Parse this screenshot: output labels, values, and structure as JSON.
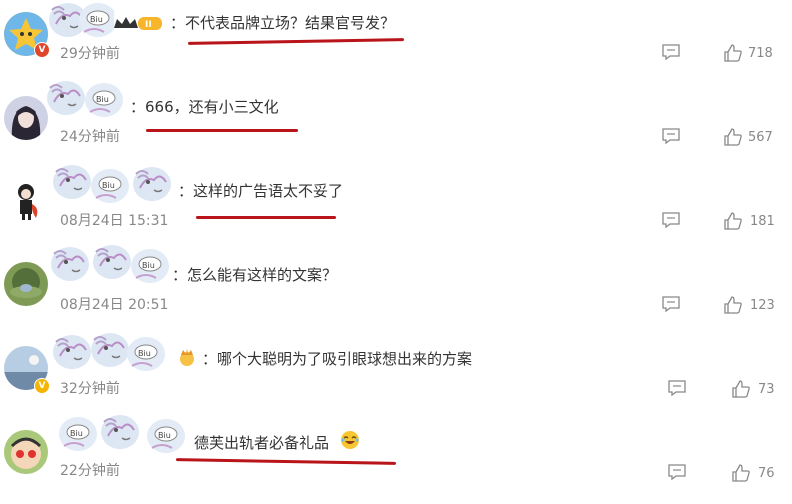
{
  "comments": [
    {
      "text": "：不代表品牌立场？结果官号发？",
      "time": "29分钟前",
      "likes": "718"
    },
    {
      "text": "：666，还有小三文化",
      "time": "24分钟前",
      "likes": "567"
    },
    {
      "text": "：这样的广告语太不妥了",
      "time": "08月24日 15:31",
      "likes": "181"
    },
    {
      "text": "：怎么能有这样的文案？",
      "time": "08月24日 20:51",
      "likes": "123"
    },
    {
      "text": "：哪个大聪明为了吸引眼球想出来的方案",
      "time": "32分钟前",
      "likes": "73"
    },
    {
      "text": "德芙出轨者必备礼品",
      "time": "22分钟前",
      "likes": "76"
    }
  ],
  "badges": {
    "vip_level": "II",
    "verified": "V"
  },
  "colors": {
    "underline": "#b8141a",
    "muted": "#888888",
    "text": "#333333"
  },
  "icons": [
    "reply-icon",
    "like-icon",
    "crown-icon",
    "laugh-emoji-icon",
    "verified-icon"
  ]
}
